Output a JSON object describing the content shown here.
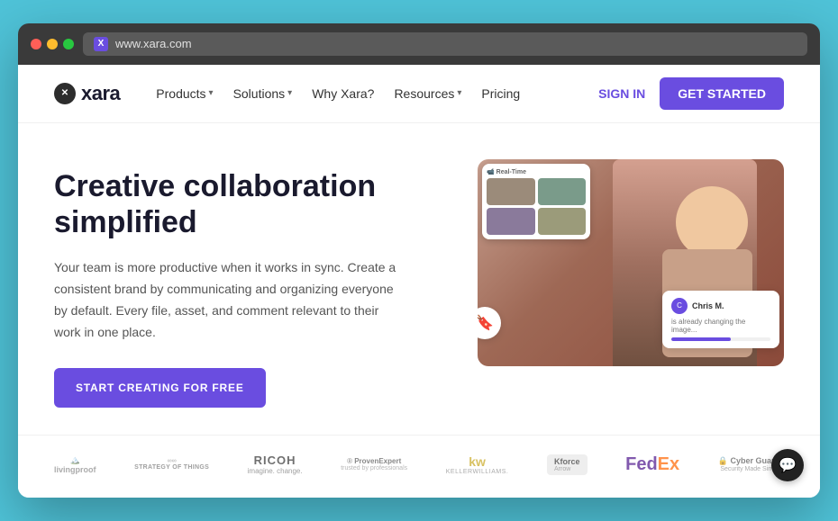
{
  "browser": {
    "url": "www.xara.com"
  },
  "navbar": {
    "logo_text": "xara",
    "nav_items": [
      {
        "label": "Products",
        "has_dropdown": true
      },
      {
        "label": "Solutions",
        "has_dropdown": true
      },
      {
        "label": "Why Xara?",
        "has_dropdown": false
      },
      {
        "label": "Resources",
        "has_dropdown": true
      },
      {
        "label": "Pricing",
        "has_dropdown": false
      }
    ],
    "sign_in_label": "SIGN IN",
    "get_started_label": "GET STARTED"
  },
  "hero": {
    "title": "Creative collaboration simplified",
    "subtitle": "Your team is more productive when it works in sync. Create a consistent brand by communicating and organizing everyone by default. Every file, asset, and comment relevant to their work in one place.",
    "cta_label": "START CREATING FOR FREE",
    "tooltip": {
      "name": "Chris M.",
      "subtext": "is already changing the image...",
      "progress": 60
    }
  },
  "brands": [
    {
      "name": "Living Proof",
      "display": "LivingProof",
      "type": "text"
    },
    {
      "name": "Strategy of Things",
      "display": "STRATEGY OF THINGS",
      "type": "text"
    },
    {
      "name": "Ricoh",
      "display": "RICOH\nimagine. change.",
      "type": "text"
    },
    {
      "name": "Proven Expert",
      "display": "® ProvenExpert",
      "type": "text"
    },
    {
      "name": "Keller Williams",
      "display": "kw\nKELLERWILLIAMS.",
      "type": "text"
    },
    {
      "name": "Kforce",
      "display": "Kforce",
      "type": "text"
    },
    {
      "name": "FedEx",
      "display": "FedEx",
      "type": "fedex"
    },
    {
      "name": "Cyber Guards",
      "display": "🔒 Cyber Guards\nSecurity Made Simple",
      "type": "text"
    }
  ],
  "chat": {
    "icon": "💬"
  }
}
